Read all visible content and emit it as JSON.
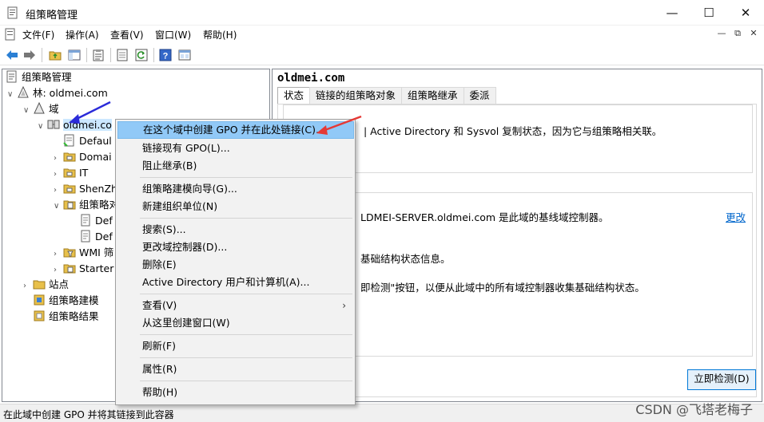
{
  "window": {
    "title": "组策略管理"
  },
  "menubar": {
    "items": [
      "文件(F)",
      "操作(A)",
      "查看(V)",
      "窗口(W)",
      "帮助(H)"
    ]
  },
  "tree": {
    "root": "组策略管理",
    "forest": "林: oldmei.com",
    "domains": "域",
    "domain": "oldmei.co",
    "children": [
      "Defaul",
      "Domai",
      "IT",
      "ShenZh",
      "组策略对",
      "Def",
      "Def",
      "WMI 筛",
      "Starter"
    ],
    "sites": "站点",
    "modeling": "组策略建模",
    "results": "组策略结果"
  },
  "details": {
    "domain_title": "oldmei.com",
    "tabs": [
      "状态",
      "链接的组策略对象",
      "组策略继承",
      "委派"
    ],
    "line1": "| Active Directory 和 Sysvol 复制状态，因为它与组策略相关联。",
    "line2": "LDMEI-SERVER.oldmei.com 是此域的基线域控制器。",
    "change_link": "更改",
    "line3": "基础结构状态信息。",
    "line4": "即检测\"按钮，以便从此域中的所有域控制器收集基础结构状态。",
    "detect_button": "立即检测(D)"
  },
  "context_menu": {
    "items": [
      "在这个域中创建 GPO 并在此处链接(C)...",
      "链接现有 GPO(L)...",
      "阻止继承(B)",
      "组策略建模向导(G)...",
      "新建组织单位(N)",
      "搜索(S)...",
      "更改域控制器(D)...",
      "删除(E)",
      "Active Directory 用户和计算机(A)...",
      "查看(V)",
      "从这里创建窗口(W)",
      "刷新(F)",
      "属性(R)",
      "帮助(H)"
    ]
  },
  "statusbar": {
    "text": "在此域中创建 GPO 并将其链接到此容器"
  },
  "watermark": "CSDN @飞塔老梅子",
  "colors": {
    "highlight": "#91c9f7",
    "selection": "#cce8ff",
    "arrow_blue": "#2b2bd9",
    "arrow_red": "#e53935"
  }
}
